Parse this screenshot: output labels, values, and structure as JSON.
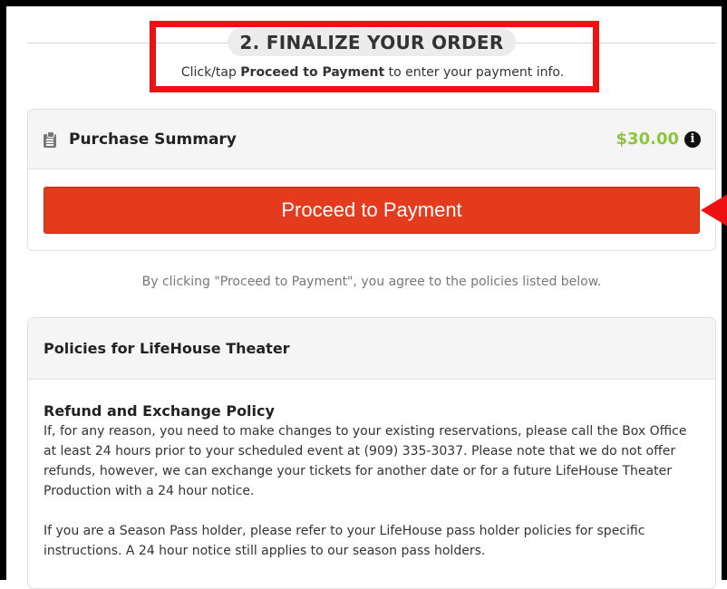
{
  "step": {
    "title": "2. FINALIZE YOUR ORDER",
    "instruction_prefix": "Click/tap ",
    "instruction_bold": "Proceed to Payment",
    "instruction_suffix": " to enter your payment info."
  },
  "summary": {
    "icon": "clipboard-list-icon",
    "title": "Purchase Summary",
    "total": "$30.00",
    "total_color": "#8cc63f",
    "info_icon": "info-circle-icon",
    "pay_button_label": "Proceed to Payment",
    "pay_button_color": "#e43a1d"
  },
  "agreement_text": "By clicking \"Proceed to Payment\", you agree to the policies listed below.",
  "policies": {
    "header": "Policies for LifeHouse Theater",
    "refund_title": "Refund and Exchange Policy",
    "refund_text": "If, for any reason, you need to make changes to your existing reservations, please call the Box Office at least 24 hours prior to your scheduled event at (909) 335-3037. Please note that we do not offer refunds, however, we can exchange your tickets for another date or for a future LifeHouse Theater Production with a 24 hour notice.",
    "season_pass_text": "If you are a Season Pass holder, please refer to your LifeHouse pass holder policies for specific instructions. A 24 hour notice still applies to our season pass holders."
  },
  "annotation_color": "#ee1111"
}
